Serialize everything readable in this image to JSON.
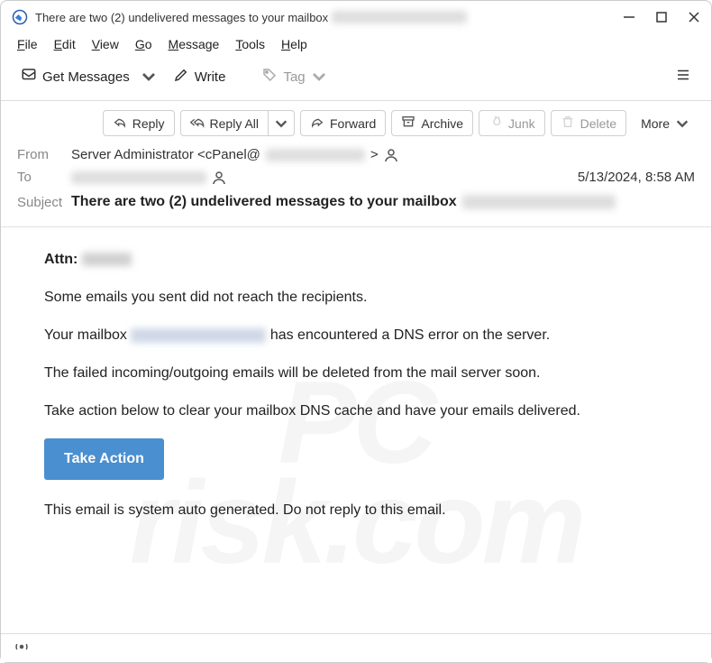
{
  "titlebar": {
    "title": "There are two (2) undelivered messages to your mailbox"
  },
  "menubar": {
    "file": "File",
    "edit": "Edit",
    "view": "View",
    "go": "Go",
    "message": "Message",
    "tools": "Tools",
    "help": "Help"
  },
  "toolbar": {
    "get_messages": "Get Messages",
    "write": "Write",
    "tag": "Tag"
  },
  "actions": {
    "reply": "Reply",
    "reply_all": "Reply All",
    "forward": "Forward",
    "archive": "Archive",
    "junk": "Junk",
    "delete": "Delete",
    "more": "More"
  },
  "header": {
    "from_label": "From",
    "from_value": "Server Administrator <cPanel@",
    "from_value_tail": ">",
    "to_label": "To",
    "datetime": "5/13/2024, 8:58 AM",
    "subject_label": "Subject",
    "subject": "There are two (2) undelivered messages to your mailbox"
  },
  "body": {
    "attn_label": "Attn:",
    "p1": "Some emails you sent did not reach the recipients.",
    "p2a": "Your mailbox",
    "p2b": "has encountered a DNS error on the server.",
    "p3": "The failed incoming/outgoing emails will be deleted from the mail server soon.",
    "p4": "Take action below to clear your mailbox DNS cache and have your emails delivered.",
    "cta": "Take Action",
    "p5": "This email is system auto generated. Do not reply to this email."
  }
}
